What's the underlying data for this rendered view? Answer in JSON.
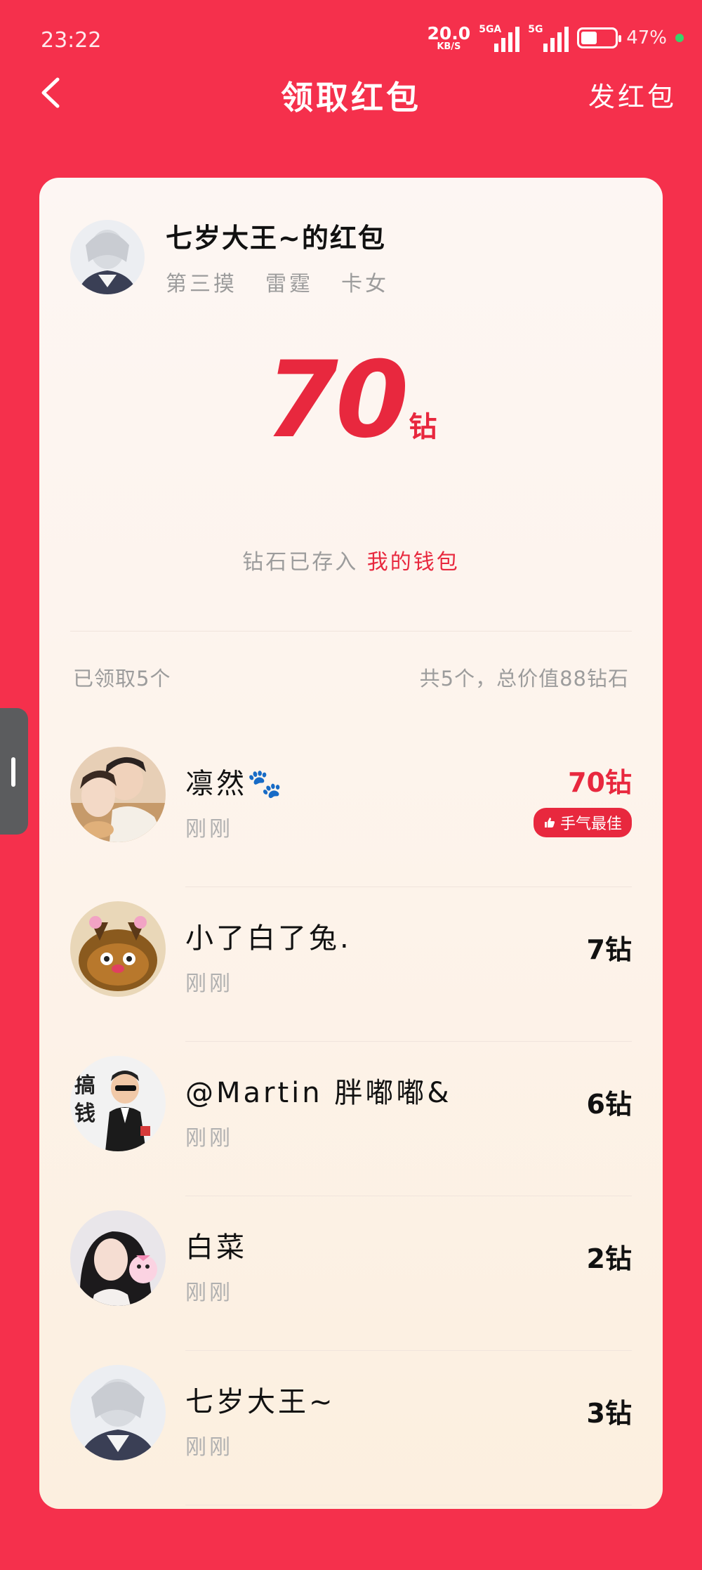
{
  "status": {
    "time": "23:22",
    "speed": "20.0",
    "speed_unit": "KB/S",
    "sim1": "5GA",
    "sim2": "5G",
    "battery": "47%",
    "battery_level": 0.47
  },
  "header": {
    "title": "领取红包",
    "send_label": "发红包"
  },
  "card": {
    "sender_name": "七岁大王~的红包",
    "sender_tags": [
      "第三摸",
      "雷霆",
      "卡女"
    ],
    "amount": "70",
    "amount_unit": "钻",
    "stored_text": "钻石已存入",
    "wallet_link": "我的钱包",
    "summary_left": "已领取5个",
    "summary_right": "共5个，总价值88钻石"
  },
  "receivers": [
    {
      "name": "凛然🐾",
      "time": "刚刚",
      "value": "70钻",
      "best": "手气最佳"
    },
    {
      "name": "小了白了兔.",
      "time": "刚刚",
      "value": "7钻"
    },
    {
      "name": "@Martin 胖嘟嘟&",
      "time": "刚刚",
      "value": "6钻"
    },
    {
      "name": "白菜",
      "time": "刚刚",
      "value": "2钻"
    },
    {
      "name": "七岁大王~",
      "time": "刚刚",
      "value": "3钻"
    }
  ],
  "colors": {
    "background": "#f5304c",
    "accent": "#e8283e",
    "card": "#fdf6f3"
  }
}
